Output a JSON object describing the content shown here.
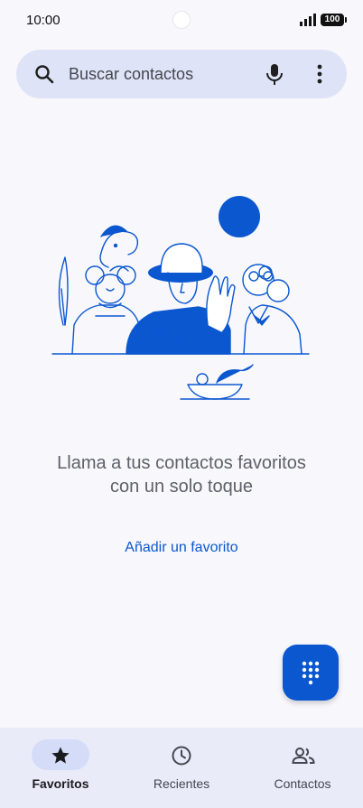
{
  "status_bar": {
    "time": "10:00",
    "battery": "100",
    "icons": [
      "signal-icon",
      "battery-icon"
    ]
  },
  "search": {
    "placeholder": "Buscar contactos",
    "icons": [
      "search-icon",
      "mic-icon",
      "more-vert-icon"
    ]
  },
  "empty_state": {
    "message": "Llama a tus contactos favoritos con un solo toque",
    "action_label": "Añadir un favorito"
  },
  "fab": {
    "icon": "dialpad-icon"
  },
  "bottom_nav": {
    "items": [
      {
        "label": "Favoritos",
        "icon": "star-icon",
        "active": true
      },
      {
        "label": "Recientes",
        "icon": "clock-icon",
        "active": false
      },
      {
        "label": "Contactos",
        "icon": "people-icon",
        "active": false
      }
    ]
  },
  "colors": {
    "accent": "#0b57d0",
    "background": "#f7f7fc",
    "search_bar": "#dfe3f7",
    "nav_bar": "#e9ebf8",
    "active_pill": "#d4dcf7"
  }
}
